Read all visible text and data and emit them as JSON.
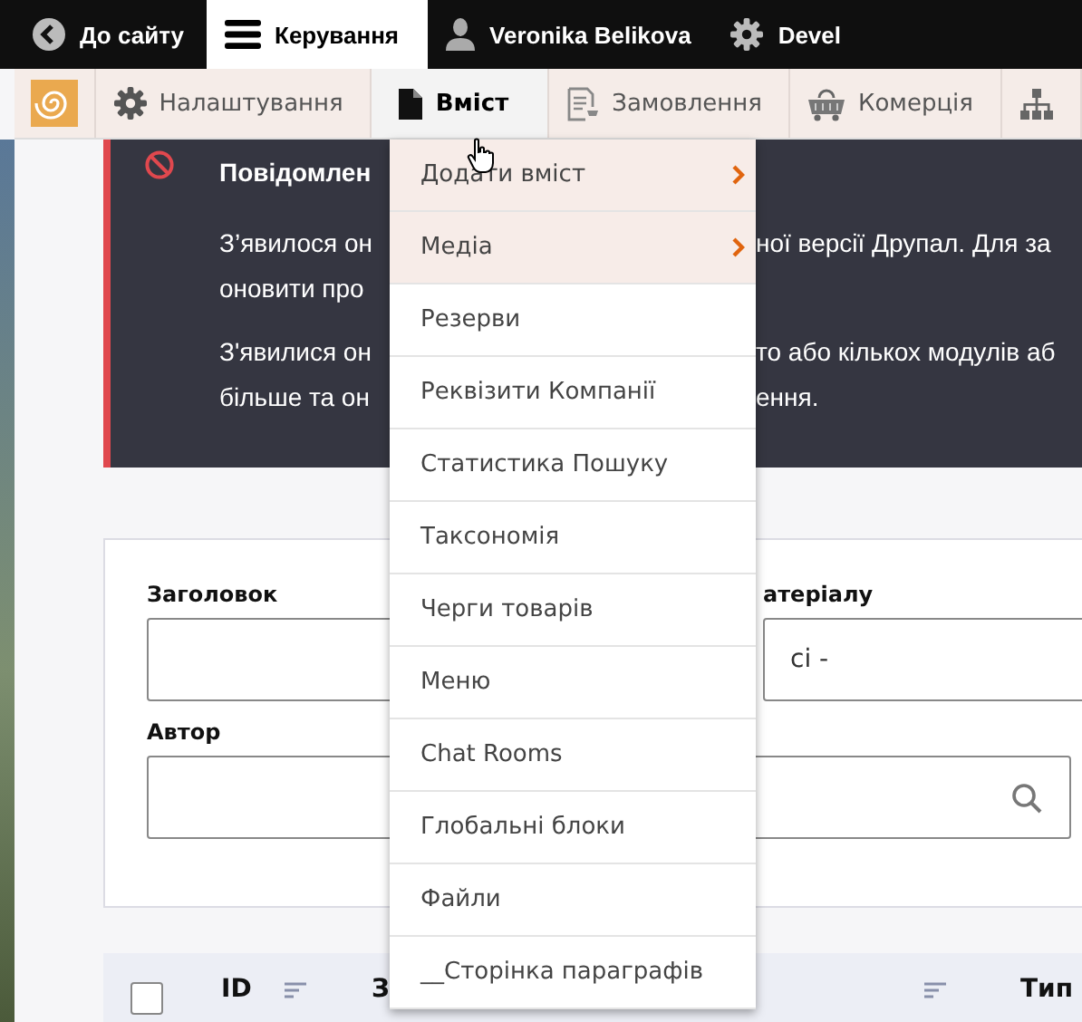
{
  "toolbar": {
    "items": [
      {
        "label": "До сайту",
        "selected": false
      },
      {
        "label": "Керування",
        "selected": true
      },
      {
        "label": "Veronika Belikova",
        "selected": false
      },
      {
        "label": "Devel",
        "selected": false
      }
    ]
  },
  "tray": {
    "items": [
      {
        "label": "Налаштування",
        "selected": false
      },
      {
        "label": "Вміст",
        "selected": true
      },
      {
        "label": "Замовлення",
        "selected": false
      },
      {
        "label": "Комерція",
        "selected": false
      },
      {
        "selected": false
      }
    ]
  },
  "message": {
    "lines": [
      {
        "kind": "title",
        "left": "Повідомлен"
      },
      {
        "kind": "text",
        "left": "З’явилося он",
        "right": "ної версії Друпал. Для за"
      },
      {
        "kind": "text",
        "left": "оновити про"
      },
      {
        "kind": "paragraph",
        "left": "З'явилися он",
        "right": "то або кількох модулів аб"
      },
      {
        "kind": "text",
        "left": "більше та он",
        "right": "ення."
      }
    ]
  },
  "filters": {
    "title_label": "Заголовок",
    "type_label": "атеріалу",
    "type_value": "сі -",
    "author_label": "Автор"
  },
  "table": {
    "select_all": {
      "checked": false
    },
    "columns": [
      {
        "label": "ID"
      },
      {
        "label": "З"
      },
      {
        "label": "Тип"
      }
    ]
  },
  "dropdown": {
    "items": [
      {
        "label": "Додати вміст",
        "has_children": true
      },
      {
        "label": "Медіа",
        "has_children": true
      },
      {
        "label": "Резерви",
        "has_children": false
      },
      {
        "label": "Реквізити Компанії",
        "has_children": false
      },
      {
        "label": "Статистика Пошуку",
        "has_children": false
      },
      {
        "label": "Таксономія",
        "has_children": false
      },
      {
        "label": "Черги товарів",
        "has_children": false
      },
      {
        "label": "Меню",
        "has_children": false
      },
      {
        "label": "Chat Rooms",
        "has_children": false
      },
      {
        "label": "Глобальні блоки",
        "has_children": false
      },
      {
        "label": "Файли",
        "has_children": false
      },
      {
        "label": "__Сторінка параграфів",
        "has_children": false
      }
    ]
  }
}
